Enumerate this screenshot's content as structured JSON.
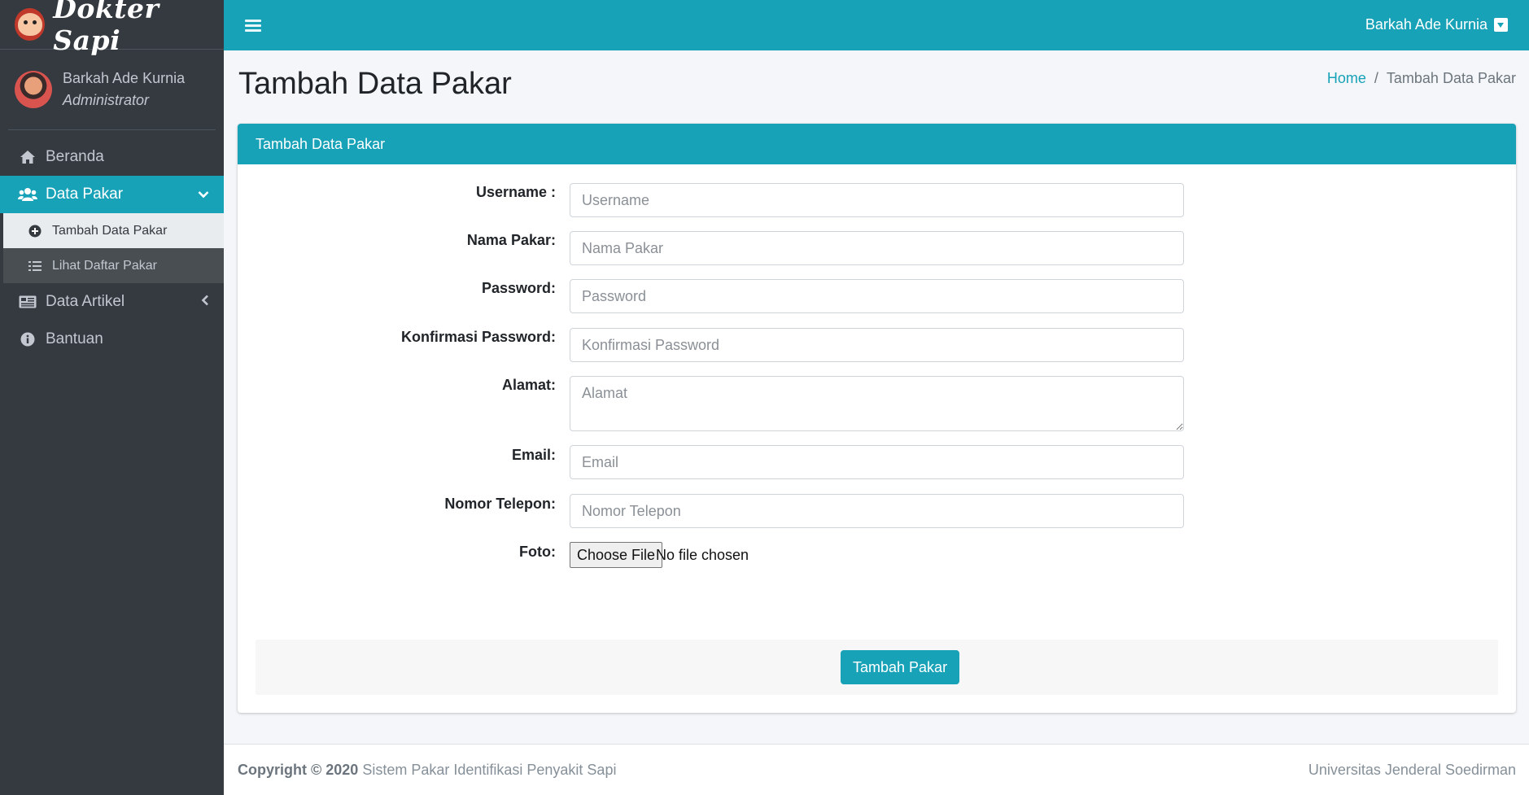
{
  "brand": {
    "name": "Dokter Sapi"
  },
  "user_panel": {
    "name": "Barkah Ade Kurnia",
    "role": "Administrator"
  },
  "sidebar": {
    "items": [
      {
        "label": "Beranda",
        "icon": "home-icon"
      },
      {
        "label": "Data Pakar",
        "icon": "users-icon",
        "active": true,
        "children": [
          {
            "label": "Tambah Data Pakar",
            "icon": "plus-circle-icon",
            "active": true
          },
          {
            "label": "Lihat Daftar Pakar",
            "icon": "list-icon"
          }
        ]
      },
      {
        "label": "Data Artikel",
        "icon": "newspaper-icon"
      },
      {
        "label": "Bantuan",
        "icon": "info-circle-icon"
      }
    ]
  },
  "topbar": {
    "user_name": "Barkah Ade Kurnia"
  },
  "page": {
    "title": "Tambah Data Pakar",
    "breadcrumb": {
      "home": "Home",
      "separator": "/",
      "current": "Tambah Data Pakar"
    }
  },
  "card": {
    "header": "Tambah Data Pakar",
    "fields": {
      "username": {
        "label": "Username :",
        "placeholder": "Username"
      },
      "nama": {
        "label": "Nama Pakar:",
        "placeholder": "Nama Pakar"
      },
      "password": {
        "label": "Password:",
        "placeholder": "Password"
      },
      "konfirmasi": {
        "label": "Konfirmasi Password:",
        "placeholder": "Konfirmasi Password"
      },
      "alamat": {
        "label": "Alamat:",
        "placeholder": "Alamat"
      },
      "email": {
        "label": "Email:",
        "placeholder": "Email"
      },
      "telepon": {
        "label": "Nomor Telepon:",
        "placeholder": "Nomor Telepon"
      },
      "foto": {
        "label": "Foto:",
        "button": "Choose File",
        "status": "No file chosen"
      }
    },
    "submit": "Tambah Pakar"
  },
  "footer": {
    "copyright": "Copyright © 2020",
    "app_name": " Sistem Pakar Identifikasi Penyakit Sapi",
    "institution": "Universitas Jenderal Soedirman"
  },
  "colors": {
    "accent": "#17a2b8",
    "sidebar": "#343a40"
  }
}
